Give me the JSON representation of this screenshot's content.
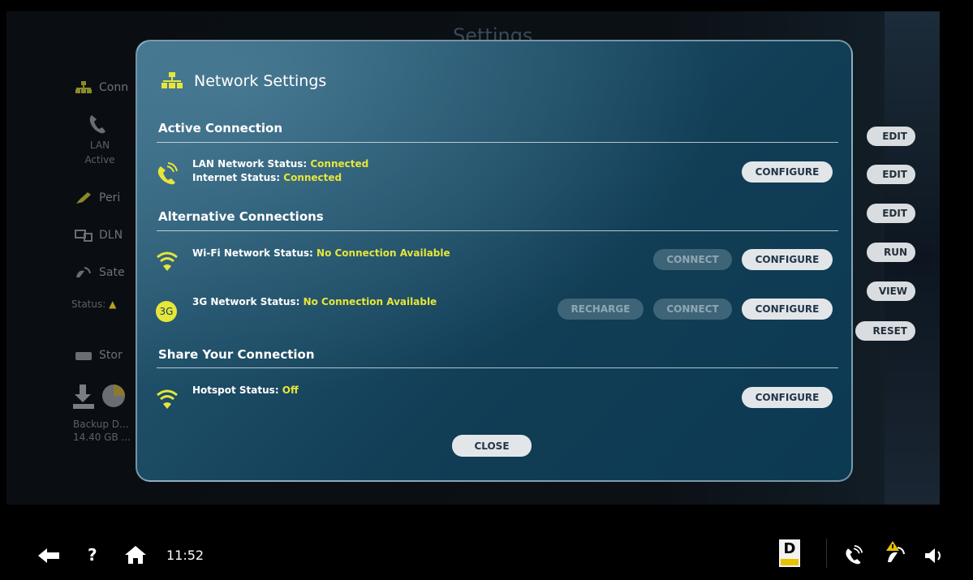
{
  "background": {
    "title": "Settings",
    "sidebar": [
      {
        "label": "Conn",
        "icon": "network-icon"
      },
      {
        "label": "LAN",
        "icon": "lan-phone-icon"
      },
      {
        "label": "Active",
        "icon": ""
      },
      {
        "label": "Peri",
        "icon": "pen-icon"
      },
      {
        "label": "DLN",
        "icon": "dlna-icon"
      },
      {
        "label": "Sate",
        "icon": "satellite-icon"
      },
      {
        "label": "Status:",
        "icon": "warning-icon"
      },
      {
        "label": "Stor",
        "icon": "storage-icon"
      },
      {
        "label": "Backup D...",
        "icon": "download-icon"
      },
      {
        "label": "14.40 GB ...",
        "icon": ""
      }
    ],
    "buttons": [
      "EDIT",
      "EDIT",
      "EDIT",
      "RUN",
      "VIEW",
      "RESET"
    ]
  },
  "modal": {
    "title": "Network Settings",
    "sections": {
      "active": {
        "title": "Active Connection",
        "lan_label": "LAN Network Status: ",
        "lan_value": "Connected",
        "internet_label": "Internet Status: ",
        "internet_value": "Connected",
        "configure": "CONFIGURE"
      },
      "alternative": {
        "title": "Alternative Connections",
        "wifi_label": "Wi-Fi Network Status: ",
        "wifi_value": "No Connection Available",
        "wifi_connect": "CONNECT",
        "wifi_configure": "CONFIGURE",
        "g3_badge": "3G",
        "g3_label": "3G Network Status: ",
        "g3_value": "No Connection Available",
        "g3_recharge": "RECHARGE",
        "g3_connect": "CONNECT",
        "g3_configure": "CONFIGURE"
      },
      "share": {
        "title": "Share Your Connection",
        "hotspot_label": "Hotspot Status: ",
        "hotspot_value": "Off",
        "configure": "CONFIGURE"
      }
    },
    "close": "CLOSE"
  },
  "bottom_bar": {
    "time": "11:52",
    "help": "?",
    "logo_letter": "D"
  },
  "colors": {
    "accent_yellow": "#e6e63a",
    "modal_bg": "#113d55",
    "button_bg": "#e3e6e8",
    "button_text": "#21354a"
  }
}
